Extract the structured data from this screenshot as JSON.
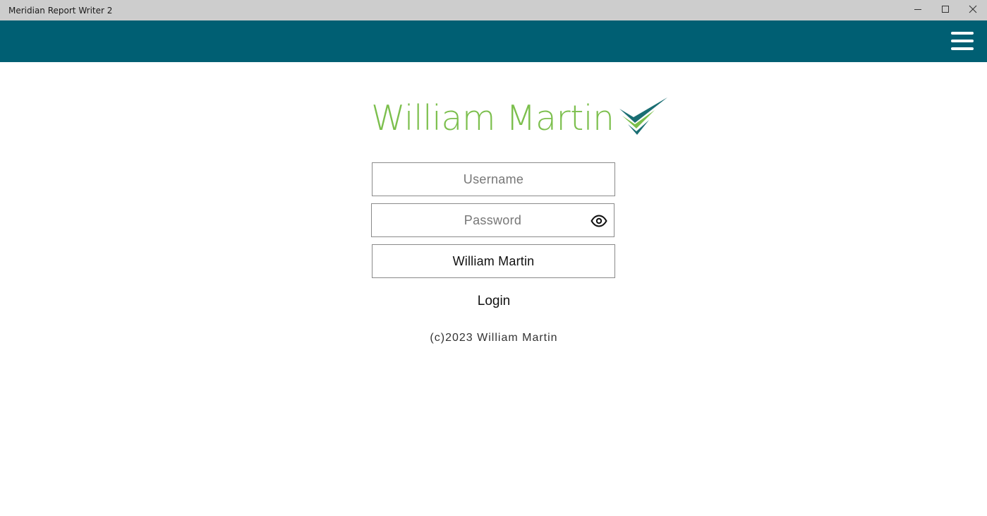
{
  "window": {
    "title": "Meridian Report Writer 2",
    "controls": [
      "minimize-icon",
      "maximize-icon",
      "close-icon"
    ]
  },
  "header": {
    "background_color": "#005f73",
    "menu_icon": "hamburger-menu-icon"
  },
  "logo": {
    "text": "William Martin",
    "text_color": "#7cbf4d",
    "mark_colors": [
      "#1a6e73",
      "#7cbf4d"
    ]
  },
  "form": {
    "username": {
      "placeholder": "Username",
      "value": ""
    },
    "password": {
      "placeholder": "Password",
      "value": "",
      "toggle_icon": "eye-icon"
    },
    "company": {
      "value": "William Martin"
    },
    "login_label": "Login"
  },
  "footer": {
    "copyright": "(c)2023 William Martin"
  }
}
